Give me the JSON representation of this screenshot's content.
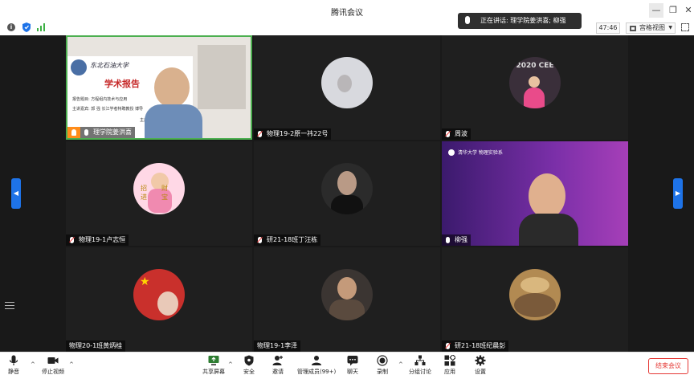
{
  "window": {
    "title": "腾讯会议"
  },
  "speaking": {
    "label": "正在讲话: 理学院姜洪喜; 柳强"
  },
  "timer": {
    "value": "47:46"
  },
  "view": {
    "label": "宫格视图"
  },
  "participants": [
    {
      "name": "理学院姜洪喜",
      "host": true,
      "mic": "on",
      "type": "video-slide",
      "slide_org": "东北石油大学",
      "slide_title": "学术报告",
      "slide_lines": [
        "报告题目: 方程组内技术与应用",
        "主讲嘉宾: 郭 强 长江学者特聘教授 博导",
        "主办单位:"
      ]
    },
    {
      "name": "物理19-2原一祎22号",
      "mic": "muted",
      "type": "avatar",
      "avatar_color": "#d8d9de"
    },
    {
      "name": "周波",
      "mic": "muted",
      "type": "avatar",
      "avatar_color": "#3a2f3a",
      "avatar_text": "2020 CEE"
    },
    {
      "name": "物理19-1卢志恒",
      "mic": "muted",
      "type": "avatar",
      "avatar_color": "#ffd8e6",
      "avatar_text": "招财进宝"
    },
    {
      "name": "研21-18班丁汪栋",
      "mic": "muted",
      "type": "avatar",
      "avatar_color": "#2b2b2b"
    },
    {
      "name": "柳强",
      "mic": "on",
      "type": "video-banner",
      "banner_text": "清华大学 物理实验系"
    },
    {
      "name": "物理20-1班黄炳桂",
      "mic": "none",
      "type": "avatar",
      "avatar_color": "#c9302c"
    },
    {
      "name": "物理19-1李泽",
      "mic": "none",
      "type": "avatar",
      "avatar_color": "#3b3532"
    },
    {
      "name": "研21-18班纪晨彭",
      "mic": "muted",
      "type": "avatar",
      "avatar_color": "#b28a52"
    }
  ],
  "toolbar": {
    "mute": "静音",
    "stop_video": "停止视频",
    "share": "共享屏幕",
    "security": "安全",
    "invite": "邀请",
    "members": "管理成员(99+)",
    "chat": "聊天",
    "record": "录制",
    "breakout": "分组讨论",
    "apps": "应用",
    "settings": "设置",
    "end": "结束会议"
  },
  "colors": {
    "accent": "#1e73e8",
    "end": "#e53935",
    "host": "#ff8c1a",
    "active_border": "#4caf50",
    "signal": "#3cb043"
  }
}
